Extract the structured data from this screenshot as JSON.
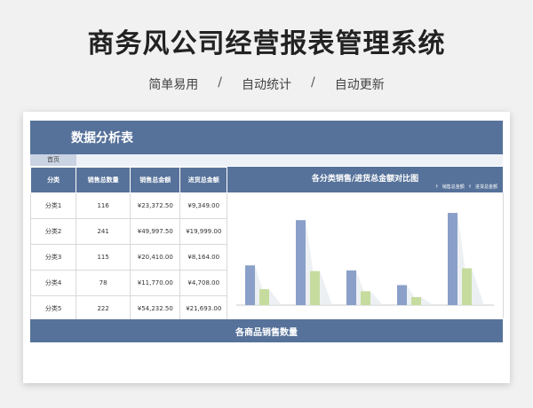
{
  "header": {
    "title": "商务风公司经营报表管理系统",
    "features": [
      "简单易用",
      "自动统计",
      "自动更新"
    ],
    "separator": "/"
  },
  "sheet": {
    "banner_title": "数据分析表",
    "tab_home": "首页",
    "table": {
      "headers": [
        "分类",
        "销售总数量",
        "销售总金额",
        "进货总金额"
      ],
      "rows": [
        [
          "分类1",
          "116",
          "¥23,372.50",
          "¥9,349.00"
        ],
        [
          "分类2",
          "241",
          "¥49,997.50",
          "¥19,999.00"
        ],
        [
          "分类3",
          "115",
          "¥20,410.00",
          "¥8,164.00"
        ],
        [
          "分类4",
          "78",
          "¥11,770.00",
          "¥4,708.00"
        ],
        [
          "分类5",
          "222",
          "¥54,232.50",
          "¥21,693.00"
        ]
      ]
    },
    "bottom_title": "各商品销售数量"
  },
  "chart_data": {
    "type": "bar",
    "title": "各分类销售/进货总金额对比图",
    "categories": [
      "分类1",
      "分类2",
      "分类3",
      "分类4",
      "分类5"
    ],
    "series": [
      {
        "name": "销售总金额",
        "values": [
          23372.5,
          49997.5,
          20410,
          11770,
          54232.5
        ],
        "color": "#8aa0c9"
      },
      {
        "name": "进货总金额",
        "values": [
          9349,
          19999,
          8164,
          4708,
          21693
        ],
        "color": "#c6dc9e"
      }
    ],
    "ylim": [
      0,
      60000
    ],
    "legend": "top-right",
    "grid": false,
    "legend_marker": "↑"
  }
}
